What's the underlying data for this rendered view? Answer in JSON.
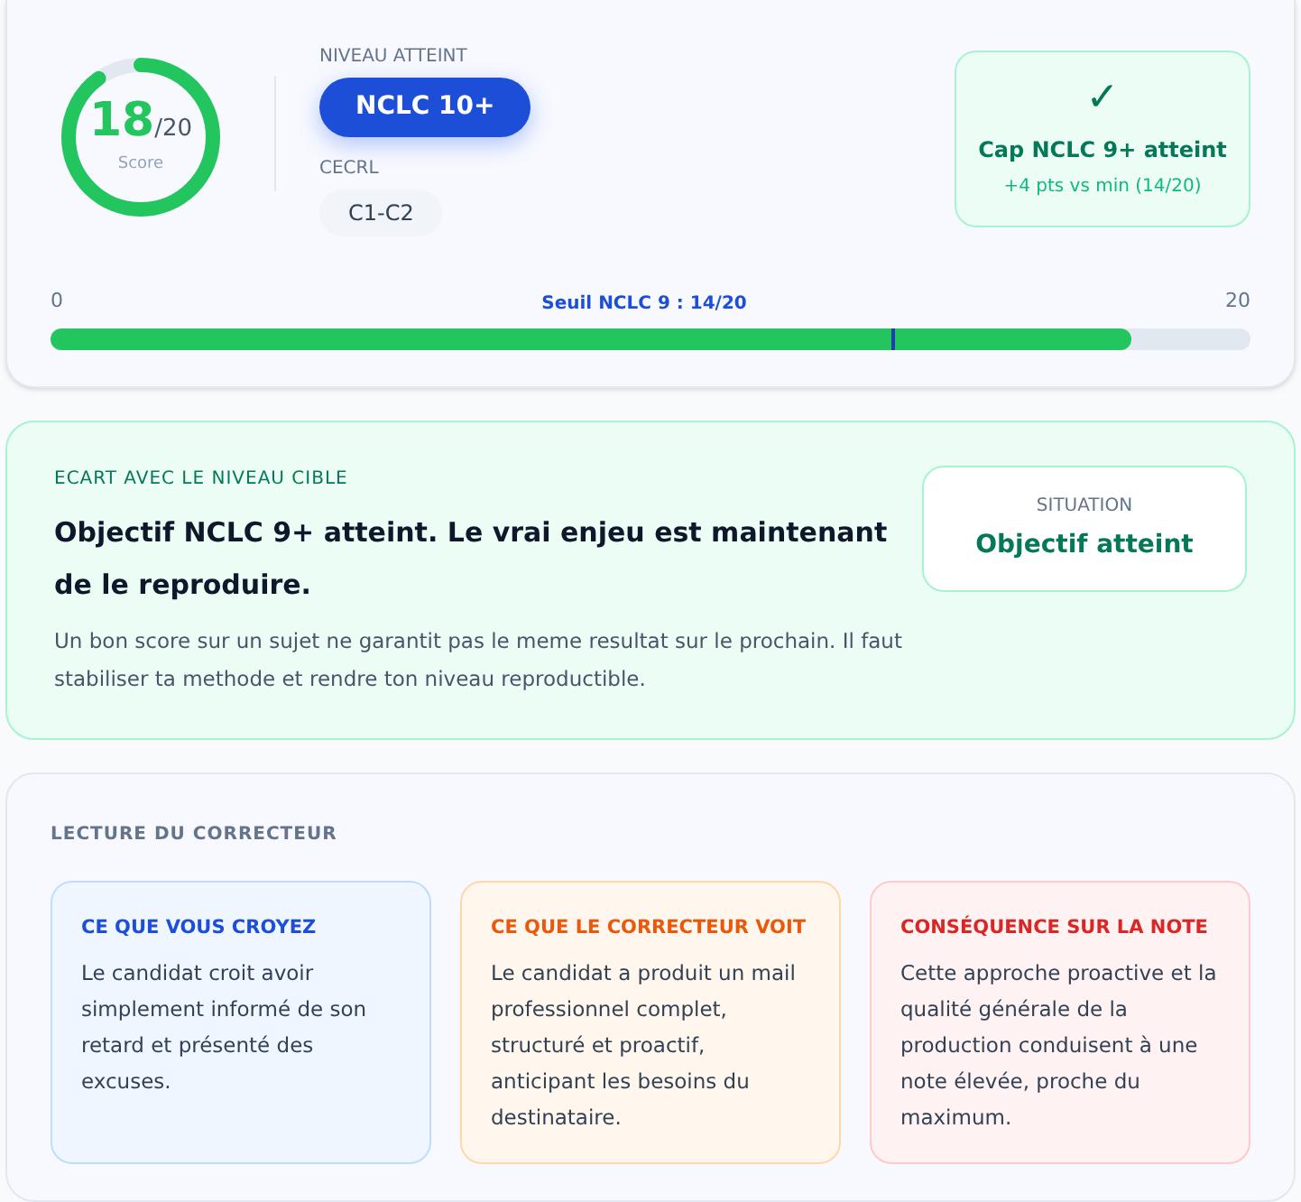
{
  "score": {
    "value": "18",
    "total": "/20",
    "label": "Score",
    "level": 0.9
  },
  "level_info": {
    "level_label": "NIVEAU ATTEINT",
    "level_badge": "NCLC 10+",
    "cecrl_label": "CECRL",
    "cecrl_badge": "C1-C2"
  },
  "status": {
    "icon": "✓",
    "title": "Cap NCLC 9+ atteint",
    "detail": "+4 pts vs min (14/20)"
  },
  "progress": {
    "start": "0",
    "threshold_label": "Seuil NCLC 9 : 14/20",
    "end": "20",
    "level": 0.9,
    "threshold": {
      "level": 0.7
    }
  },
  "gap": {
    "eyebrow": "ECART AVEC LE NIVEAU CIBLE",
    "heading": "Objectif NCLC 9+ atteint. Le vrai enjeu est maintenant de le reproduire.",
    "body": "Un bon score sur un sujet ne garantit pas le meme resultat sur le prochain. Il faut stabiliser ta methode et rendre ton niveau reproductible.",
    "situation_label": "SITUATION",
    "situation_value": "Objectif atteint"
  },
  "reading": {
    "title": "LECTURE DU CORRECTEUR",
    "cards": [
      {
        "kind": "belief",
        "title": "CE QUE VOUS CROYEZ",
        "text": "Le candidat croit avoir simplement informé de son retard et présenté des excuses."
      },
      {
        "kind": "observation",
        "title": "CE QUE LE CORRECTEUR VOIT",
        "text": "Le candidat a produit un mail professionnel complet, structuré et proactif, anticipant les besoins du destinataire."
      },
      {
        "kind": "consequence",
        "title": "CONSÉQUENCE SUR LA NOTE",
        "text": "Cette approche proactive et la qualité générale de la production conduisent à une note élevée, proche du maximum."
      }
    ]
  }
}
